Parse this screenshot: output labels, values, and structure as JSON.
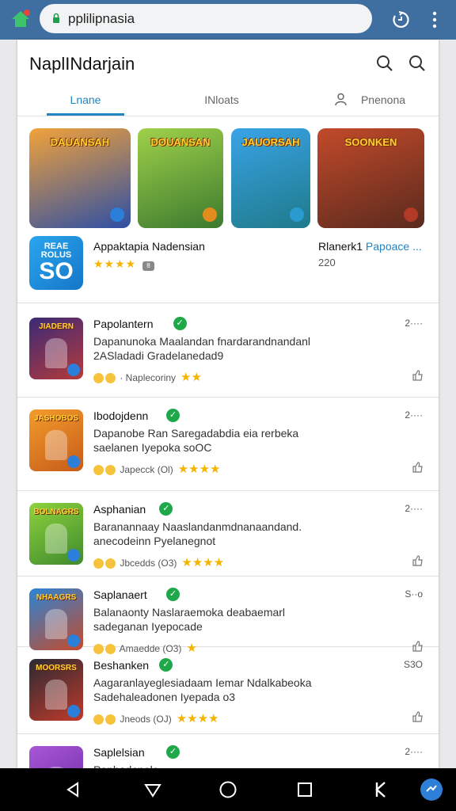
{
  "browser": {
    "url": "pplilipnasia"
  },
  "header": {
    "title": "NaplINdarjain"
  },
  "tabs": [
    {
      "label": "Lnane"
    },
    {
      "label": "INloats"
    },
    {
      "label": "Pnenona"
    }
  ],
  "featured_banners": [
    {
      "title": "DAUANSAH",
      "colors": [
        "#f2a23a",
        "#2d4fa5"
      ],
      "badge_color": "#2b7fd8"
    },
    {
      "title": "DOUANSAN",
      "colors": [
        "#9fd14a",
        "#3c7a2e"
      ],
      "badge_color": "#e38b1d"
    },
    {
      "title": "JAUORSAH",
      "colors": [
        "#39a3e6",
        "#1f7a8a"
      ],
      "badge_color": "#2a9bd1"
    },
    {
      "title": "SOONKEN",
      "colors": [
        "#c24a2a",
        "#5a2a1e"
      ],
      "badge_color": "#b23b28"
    }
  ],
  "featured_row": {
    "icon_top": "REAE ROLUS",
    "icon_big": "SO",
    "name": "Appaktapia Nadensian",
    "rating": "★★★★",
    "developer_prefix": "Rlanerk1",
    "developer_highlight": "Papoace ...",
    "downloads": "220"
  },
  "list_items": [
    {
      "title": "Papolantern",
      "desc1": "Dapanunoka Maalandan fnardarandnandanl",
      "desc2": "2ASladadi Gradelanedad9",
      "meta": "· Naplecoriny",
      "extra": "★★",
      "count": "2····",
      "icon_colors": [
        "#3a2a78",
        "#b53a3a"
      ],
      "icon_label": "JIADERN"
    },
    {
      "title": "Ibodojdenn",
      "desc1": "Dapanobe Ran Saregadabdia eia rerbeka",
      "desc2": "saelanen Iyepoka soOC",
      "meta": "Japecck (Ol)",
      "extra": "★★★★",
      "count": "2····",
      "icon_colors": [
        "#f39c2b",
        "#c65b1a"
      ],
      "icon_label": "JASHOBOS"
    },
    {
      "title": "Asphanian",
      "desc1": "Baranannaay Naaslandanmdnanaandand.",
      "desc2": "anecodeinn Pyelanegnot",
      "meta": "Jbcedds (O3)",
      "extra": "★★★★",
      "count": "2····",
      "icon_colors": [
        "#8dd23e",
        "#3f8a2c"
      ],
      "icon_label": "BOLNAGRS"
    },
    {
      "title": "Saplanaert",
      "desc1": "Balanaonty Naslaraemoka deabaemarl",
      "desc2": "sadeganan Iyepocade",
      "meta": "Amaedde (O3)",
      "extra": "★",
      "count": "S··o",
      "icon_colors": [
        "#2a85d6",
        "#c64a2a"
      ],
      "icon_label": "NHAAGRS"
    },
    {
      "title": "Beshanken",
      "desc1": "Aagaranlayeglesiadaam Iemar Ndalkabeoka",
      "desc2": "Sadehaleadonen Iyepada o3",
      "meta": "Jneods (OJ)",
      "extra": "★★★★",
      "count": "S3O",
      "icon_colors": [
        "#2a2a35",
        "#c03a2a"
      ],
      "icon_label": "MOORSRS"
    },
    {
      "title": "Saplelsian",
      "desc1": "Paphadonele",
      "desc2": "",
      "meta": "",
      "extra": "",
      "count": "2····",
      "icon_colors": [
        "#a857d6",
        "#6a2aa5"
      ],
      "icon_label": ""
    }
  ]
}
